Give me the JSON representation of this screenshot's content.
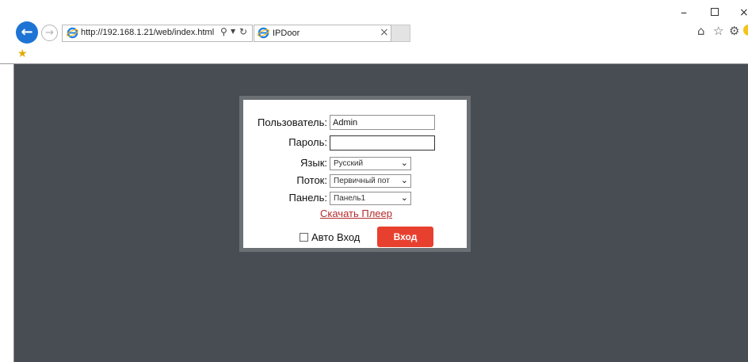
{
  "browser": {
    "url": "http://192.168.1.21/web/index.html",
    "tab_title": "IPDoor",
    "icons": [
      "back-arrow-icon",
      "forward-arrow-icon",
      "ie-icon",
      "search-icon",
      "refresh-icon",
      "close-icon",
      "home-icon",
      "star-icon",
      "gear-icon",
      "smiley-icon",
      "favorites-icon"
    ],
    "window_controls": {
      "minimize": "–",
      "close": "×"
    }
  },
  "login": {
    "user_label": "Пользователь:",
    "user_value": "Admin",
    "password_label": "Пароль:",
    "password_value": "",
    "language_label": "Язык:",
    "language_value": "Русский",
    "stream_label": "Поток:",
    "stream_value": "Первичный пот",
    "panel_label": "Панель:",
    "panel_value": "Панель1",
    "download_link": "Скачать Плеер",
    "auto_login_label": "Авто Вход",
    "auto_login_checked": false,
    "login_button": "Вход"
  },
  "colors": {
    "page_background": "#474d53",
    "login_button": "#e8402f",
    "link": "#b22a2a",
    "browser_accent": "#1e74d4"
  }
}
